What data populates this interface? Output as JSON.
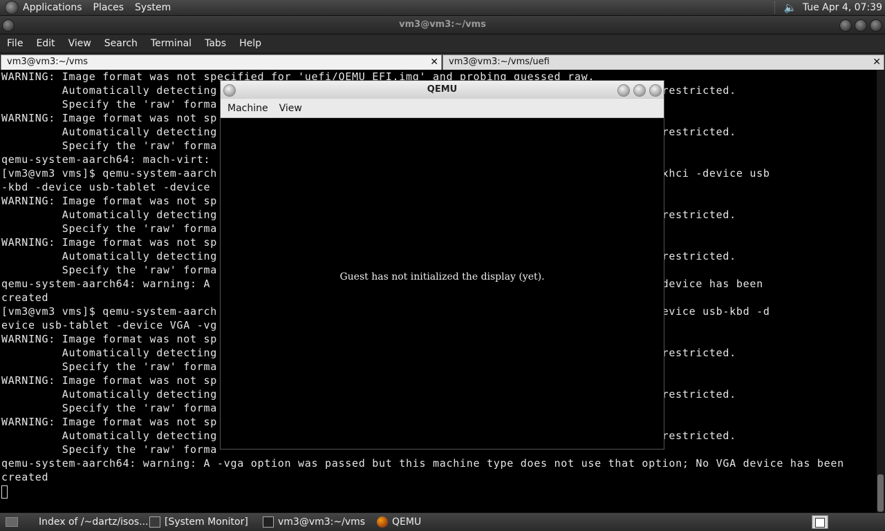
{
  "top_panel": {
    "menus": [
      "Applications",
      "Places",
      "System"
    ],
    "clock": "Tue Apr  4, 07:39",
    "volume_icon": "speaker-icon"
  },
  "terminal": {
    "title": "vm3@vm3:~/vms",
    "menus": [
      "File",
      "Edit",
      "View",
      "Search",
      "Terminal",
      "Tabs",
      "Help"
    ],
    "tabs": [
      {
        "label": "vm3@vm3:~/vms",
        "active": true
      },
      {
        "label": "vm3@vm3:~/vms/uefi",
        "active": false
      }
    ],
    "close_glyph": "✕",
    "lines": [
      "WARNING: Image format was not specified for 'uefi/QEMU_EFI.img' and probing guessed raw.",
      "         Automatically detecting                                                     ck 0 will be restricted.",
      "         Specify the 'raw' forma",
      "WARNING: Image format was not sp",
      "         Automatically detecting                                                     ck 0 will be restricted.",
      "         Specify the 'raw' forma",
      "qemu-system-aarch64: mach-virt:",
      "[vm3@vm3 vms]$ qemu-system-aarch                                                    evice nec-usb-xhci -device usb",
      "-kbd -device usb-tablet -device                                                     g",
      "WARNING: Image format was not sp",
      "         Automatically detecting                                                     ck 0 will be restricted.",
      "         Specify the 'raw' forma",
      "WARNING: Image format was not sp",
      "         Automatically detecting                                                     ck 0 will be restricted.",
      "         Specify the 'raw' forma",
      "qemu-system-aarch64: warning: A                                                     ption; No VGA device has been",
      "created",
      "[vm3@vm3 vms]$ qemu-system-aarch                                                    ec-usb-xhci -device usb-kbd -d",
      "evice usb-tablet -device VGA -vg                                                    da gptdisk.img",
      "WARNING: Image format was not sp",
      "         Automatically detecting                                                     ck 0 will be restricted.",
      "         Specify the 'raw' forma",
      "WARNING: Image format was not sp",
      "         Automatically detecting                                                     ck 0 will be restricted.",
      "         Specify the 'raw' forma",
      "WARNING: Image format was not sp",
      "         Automatically detecting                                                     ck 0 will be restricted.",
      "         Specify the 'raw' forma",
      "qemu-system-aarch64: warning: A -vga option was passed but this machine type does not use that option; No VGA device has been",
      "created"
    ]
  },
  "qemu": {
    "title": "QEMU",
    "menus": [
      "Machine",
      "View"
    ],
    "message": "Guest has not initialized the display (yet)."
  },
  "taskbar": {
    "items": [
      {
        "label": "Index of /~dartz/isos...",
        "icon": "chrome-icon"
      },
      {
        "label": "[System Monitor]",
        "icon": "system-monitor-icon"
      },
      {
        "label": "vm3@vm3:~/vms",
        "icon": "terminal-icon"
      },
      {
        "label": "QEMU",
        "icon": "qemu-icon"
      }
    ]
  }
}
